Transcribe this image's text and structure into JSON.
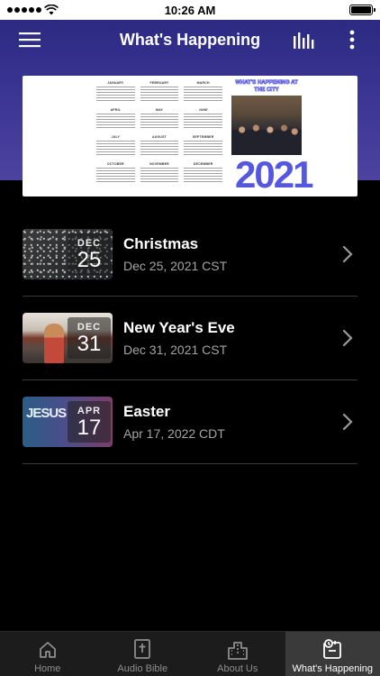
{
  "status": {
    "time": "10:26 AM"
  },
  "header": {
    "title": "What's Happening",
    "icons": [
      "menu-icon",
      "audio-bars-icon",
      "more-vert-icon"
    ]
  },
  "banner": {
    "heading": "WHAT'S HAPPENING AT THE CITY",
    "year": "2021",
    "months": [
      "JANUARY",
      "FEBRUARY",
      "MARCH",
      "APRIL",
      "MAY",
      "JUNE",
      "JULY",
      "AUGUST",
      "SEPTEMBER",
      "OCTOBER",
      "NOVEMBER",
      "DECEMBER"
    ]
  },
  "events": [
    {
      "title": "Christmas",
      "month": "DEC",
      "day": "25",
      "date": "Dec 25, 2021 CST"
    },
    {
      "title": "New Year's Eve",
      "month": "DEC",
      "day": "31",
      "date": "Dec 31, 2021 CST"
    },
    {
      "title": "Easter",
      "month": "APR",
      "day": "17",
      "date": "Apr 17, 2022 CDT",
      "thumb_text": "JESUS"
    }
  ],
  "tabs": [
    {
      "label": "Home",
      "icon": "home-icon"
    },
    {
      "label": "Audio Bible",
      "icon": "bible-icon"
    },
    {
      "label": "About Us",
      "icon": "building-icon"
    },
    {
      "label": "What's Happening",
      "icon": "calendar-events-icon",
      "active": true
    }
  ],
  "colors": {
    "header_top": "#2b2a82",
    "header_bottom": "#4d429f",
    "banner_year": "#5557e0",
    "tabbar": "#1c1c1c",
    "tab_active": "#3a3a3a"
  }
}
